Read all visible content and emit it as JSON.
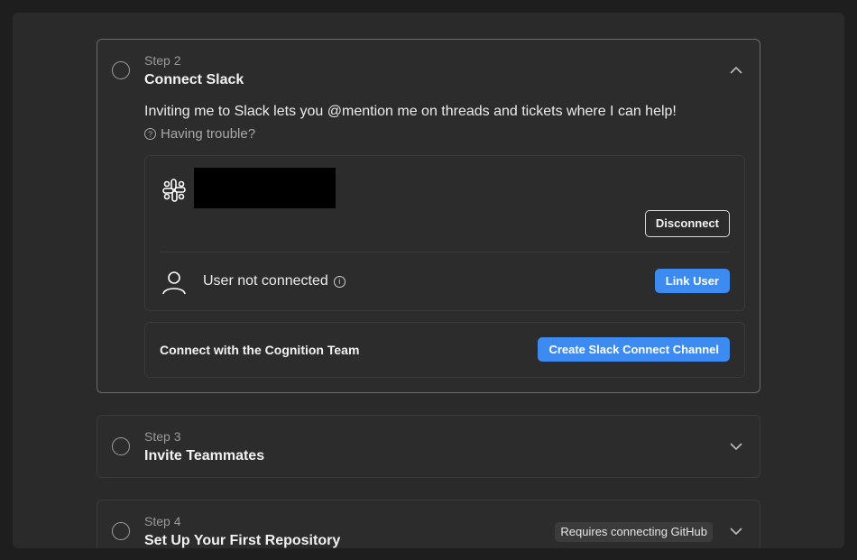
{
  "steps": {
    "step2": {
      "label": "Step 2",
      "title": "Connect Slack",
      "intro": "Inviting me to Slack lets you @mention me on threads and tickets where I can help!",
      "trouble": "Having trouble?",
      "disconnect": "Disconnect",
      "user_status": "User not connected",
      "link_user": "Link User",
      "cognition_text": "Connect with the Cognition Team",
      "create_channel": "Create Slack Connect Channel",
      "icons": [
        "slack-icon",
        "user-icon",
        "info-icon",
        "help-circle-icon",
        "chevron-up-icon"
      ]
    },
    "step3": {
      "label": "Step 3",
      "title": "Invite Teammates"
    },
    "step4": {
      "label": "Step 4",
      "title": "Set Up Your First Repository",
      "badge": "Requires connecting GitHub"
    }
  },
  "colors": {
    "background": "#1e1e1e",
    "card": "#2c2c2c",
    "accent_blue": "#3d8bf0"
  }
}
